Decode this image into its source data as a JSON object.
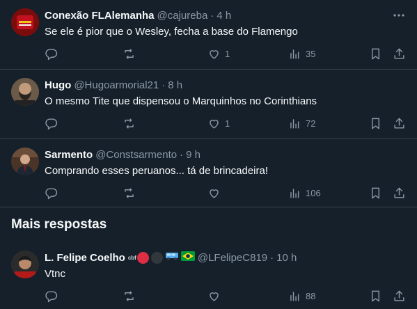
{
  "replies": [
    {
      "name": "Conexão FLAlemanha",
      "handle": "@cajureba",
      "sep": "·",
      "time": "4 h",
      "text": "Se ele é pior que o Wesley, fecha a base do Flamengo",
      "likes": "1",
      "views": "35",
      "avatar_color": "#8a0f0f"
    },
    {
      "name": "Hugo",
      "handle": "@Hugoarmorial21",
      "sep": "·",
      "time": "8 h",
      "text": "O mesmo Tite que dispensou o Marquinhos no Corinthians",
      "likes": "1",
      "views": "72",
      "avatar_color": "#5b4a3a"
    },
    {
      "name": "Sarmento",
      "handle": "@Constsarmento",
      "sep": "·",
      "time": "9 h",
      "text": "Comprando esses peruanos... tá de brincadeira!",
      "likes": "",
      "views": "106",
      "avatar_color": "#3a2a22"
    }
  ],
  "section": {
    "title": "Mais respostas"
  },
  "more_reply": {
    "name": "L. Felipe Coelho",
    "badge_text": "cbf",
    "handle": "@LFelipeC819",
    "sep": "·",
    "time": "10 h",
    "text": "Vtnc",
    "views": "88",
    "avatar_color": "#3b3b3b"
  },
  "icons": {
    "reply": "reply-icon",
    "retweet": "retweet-icon",
    "like": "like-icon",
    "views": "views-icon",
    "bookmark": "bookmark-icon",
    "share": "share-icon",
    "more": "more-icon"
  },
  "colors": {
    "background": "#15202b",
    "divider": "#38444d",
    "secondary_text": "#8b98a5",
    "primary_text": "#f7f9f9"
  }
}
